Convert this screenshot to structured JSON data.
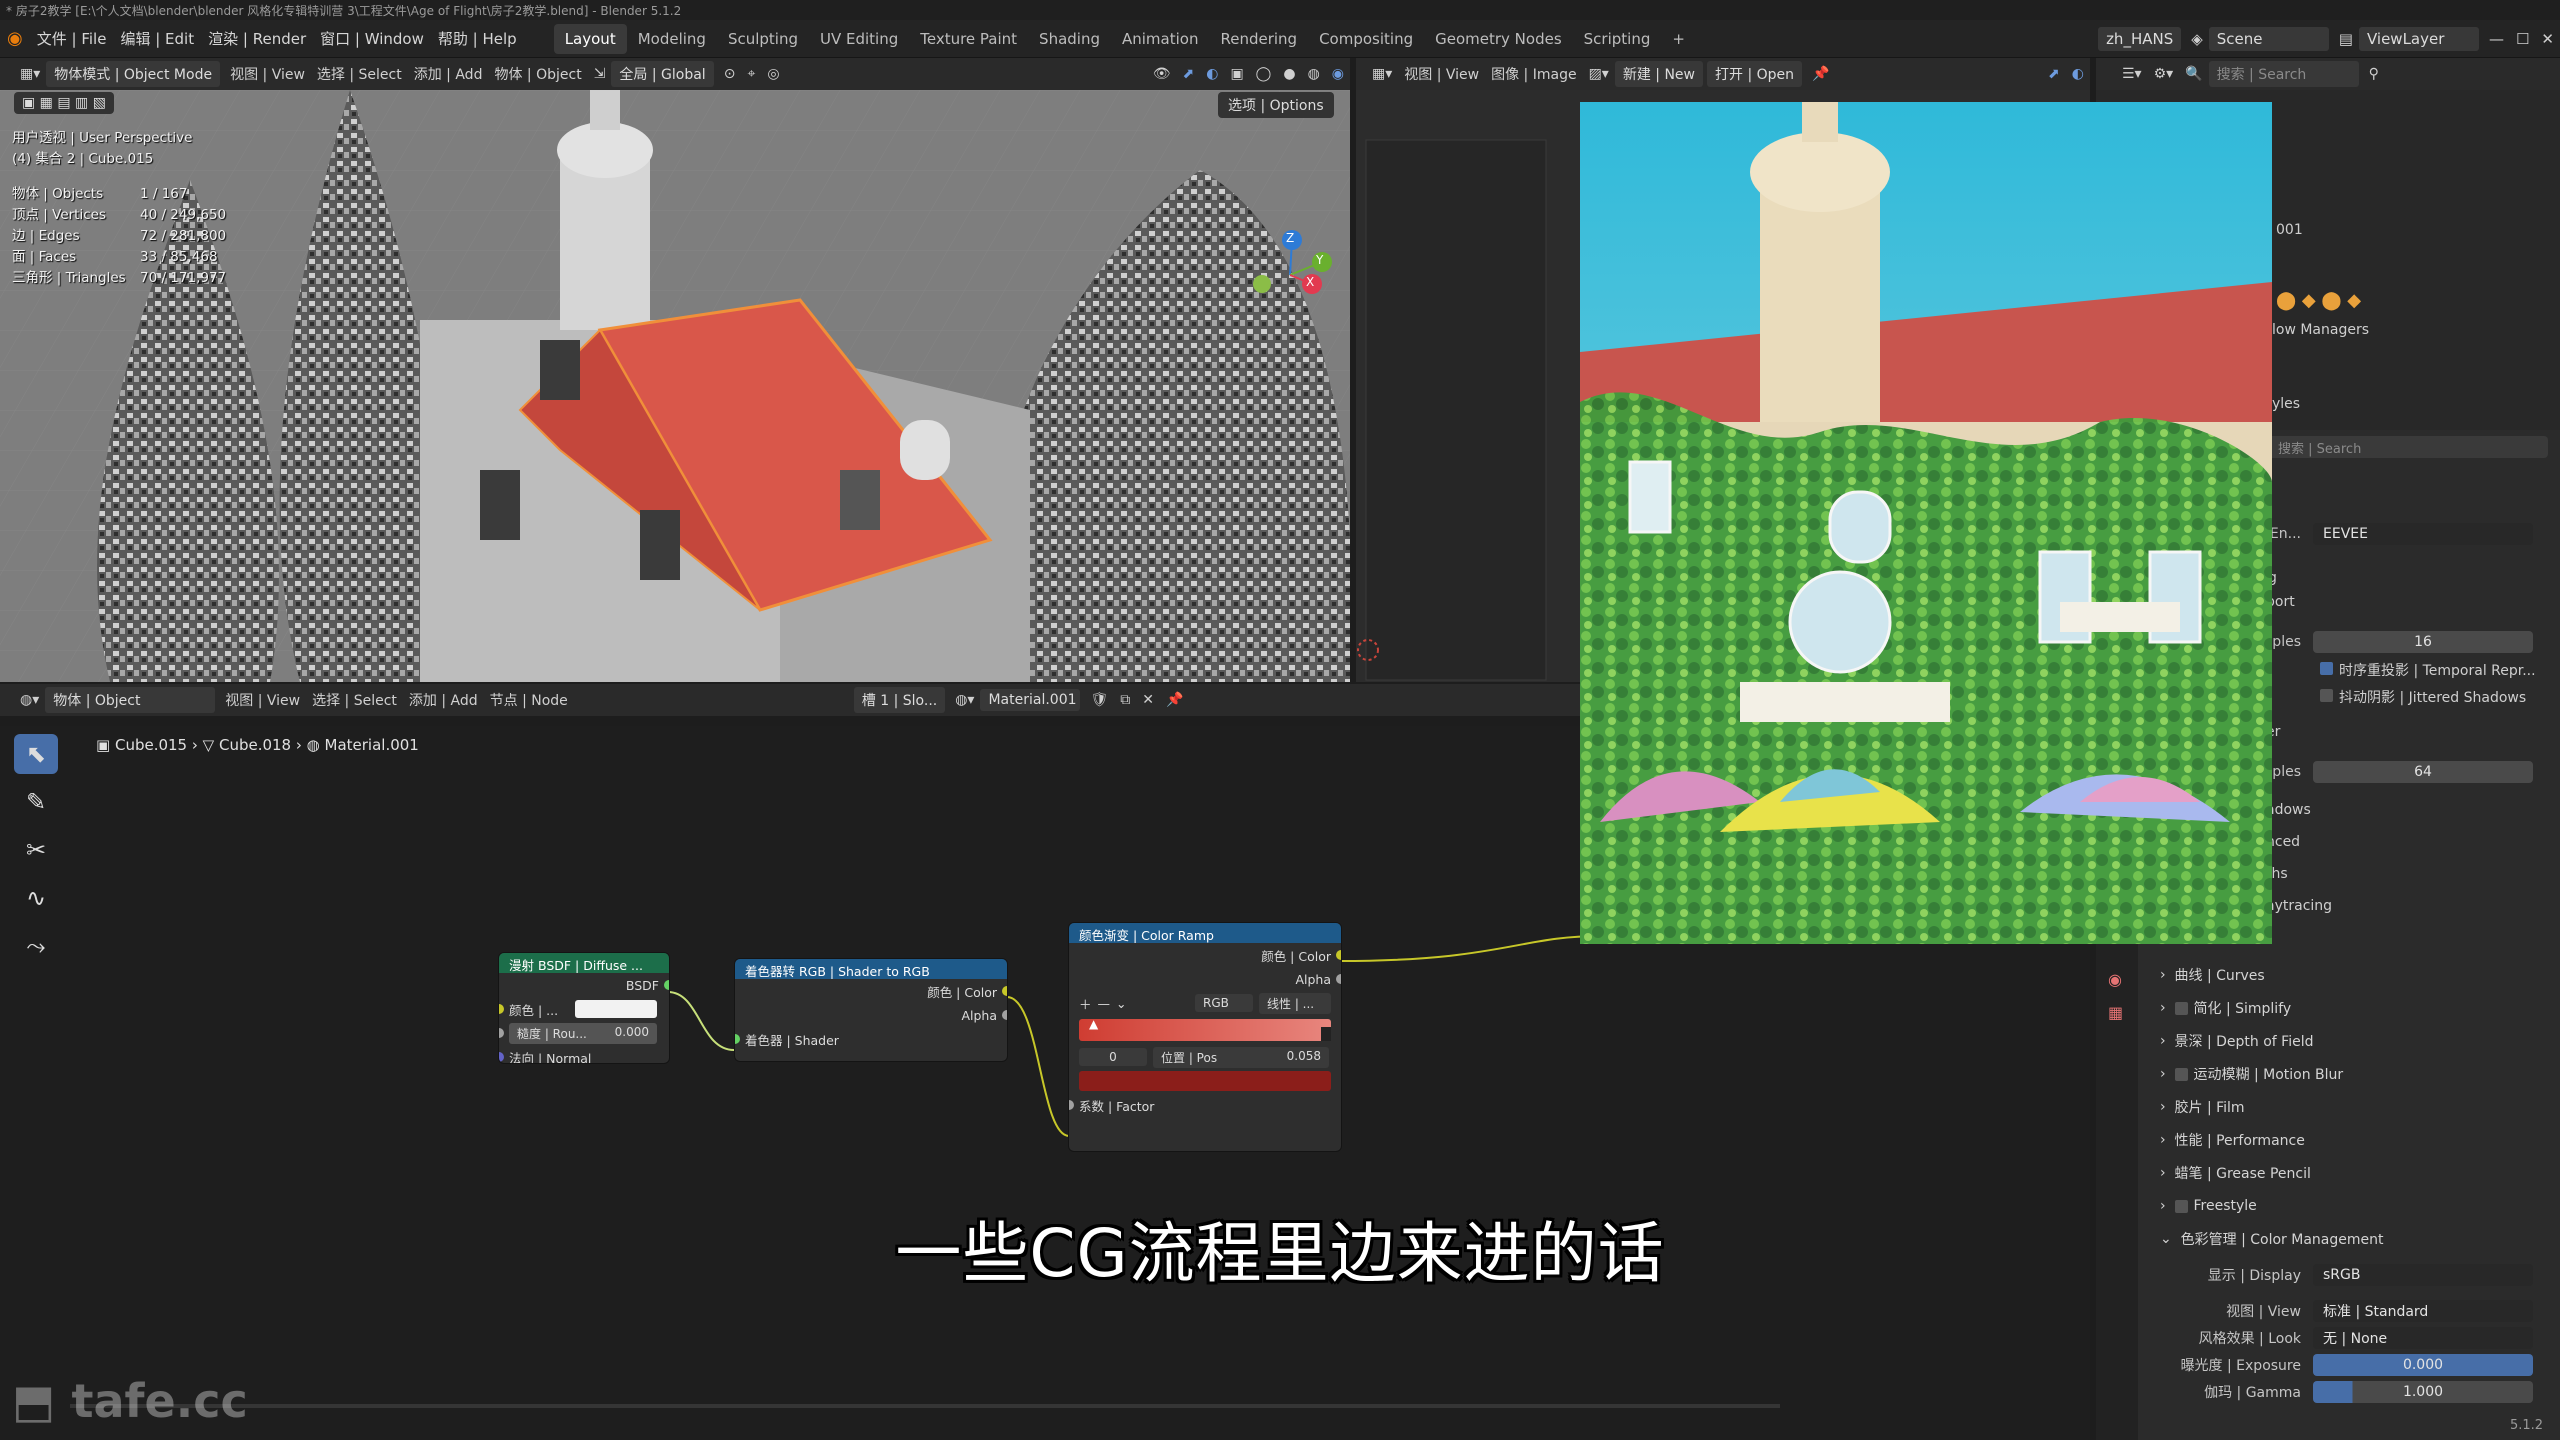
{
  "window": {
    "title": "* 房子2教学 [E:\\个人文档\\blender\\blender 风格化专辑特训营 3\\工程文件\\Age of Flight\\房子2教学.blend] - Blender 5.1.2",
    "version": "5.1.2"
  },
  "menu": [
    {
      "zh": "文件",
      "en": "File"
    },
    {
      "zh": "编辑",
      "en": "Edit"
    },
    {
      "zh": "渲染",
      "en": "Render"
    },
    {
      "zh": "窗口",
      "en": "Window"
    },
    {
      "zh": "帮助",
      "en": "Help"
    }
  ],
  "workspaces": [
    "Layout",
    "Modeling",
    "Sculpting",
    "UV Editing",
    "Texture Paint",
    "Shading",
    "Animation",
    "Rendering",
    "Compositing",
    "Geometry Nodes",
    "Scripting"
  ],
  "active_workspace": "Layout",
  "top_right": {
    "language": "zh_HANS",
    "scene": "Scene",
    "view_layer": "ViewLayer"
  },
  "viewport": {
    "header": {
      "mode": "物体模式 | Object Mode",
      "view": "视图 | View",
      "select": "选择 | Select",
      "add": "添加 | Add",
      "object": "物体 | Object",
      "transform": "全局 | Global",
      "options": "选项 | Options"
    },
    "info_line1": "用户透视 | User Perspective",
    "info_line2": "(4) 集合 2 | Cube.015",
    "stats": [
      {
        "k": "物体 | Objects",
        "v": "1 / 167"
      },
      {
        "k": "顶点 | Vertices",
        "v": "40 / 249,650"
      },
      {
        "k": "边 | Edges",
        "v": "72 / 281,800"
      },
      {
        "k": "面 | Faces",
        "v": "33 / 85,468"
      },
      {
        "k": "三角形 | Triangles",
        "v": "70 / 171,977"
      }
    ],
    "axes": {
      "z": "Z",
      "y": "Y",
      "x": "X"
    }
  },
  "image_editor": {
    "view": "视图 | View",
    "image": "图像 | Image",
    "new": "新建 | New",
    "open": "打开 | Open"
  },
  "outliner": {
    "search_placeholder": "搜索 | Search",
    "item_text": "001",
    "managers": "low Managers",
    "styles": "yles"
  },
  "node_editor": {
    "header": {
      "object": "物体 | Object",
      "view": "视图 | View",
      "select": "选择 | Select",
      "add": "添加 | Add",
      "node": "节点 | Node",
      "slot": "槽 1 | Slo...",
      "material": "Material.001"
    },
    "breadcrumb": [
      "Cube.015",
      "Cube.018",
      "Material.001"
    ],
    "nodes": {
      "diffuse": {
        "title": "漫射 BSDF | Diffuse ...",
        "out": "BSDF",
        "color": "颜色 | ...",
        "rough_label": "糙度 | Rou...",
        "rough_value": "0.000",
        "normal": "法向 | Normal"
      },
      "s2r": {
        "title": "着色器转 RGB | Shader to RGB",
        "color": "颜色 | Color",
        "alpha": "Alpha",
        "shader": "着色器 | Shader"
      },
      "ramp": {
        "title": "颜色渐变 | Color Ramp",
        "color": "颜色 | Color",
        "alpha": "Alpha",
        "mode": "RGB",
        "interp": "线性 | ...",
        "index": "0",
        "pos_label": "位置 | Pos",
        "pos_value": "0.058",
        "factor": "系数 | Factor",
        "ramp_start": "#cf3d32",
        "ramp_end": "#e8867e",
        "swatch": "#8b1e1a"
      }
    }
  },
  "properties": {
    "search_placeholder": "搜索 | Search",
    "engine_label": "En...",
    "engine": "EEVEE",
    "rows": [
      {
        "label": "nples",
        "value": "16"
      },
      {
        "label": "nples",
        "value": "64"
      }
    ],
    "temporal": "时序重投影 | Temporal Repr...",
    "jittered": "抖动阴影 | Jittered Shadows",
    "fragments": [
      "g",
      "port",
      "er",
      "adows",
      "nced",
      "ths",
      "aytracing"
    ],
    "sections": [
      "曲线 | Curves",
      "简化 | Simplify",
      "景深 | Depth of Field",
      "运动模糊 | Motion Blur",
      "胶片 | Film",
      "性能 | Performance",
      "蜡笔 | Grease Pencil",
      "Freestyle",
      "色彩管理 | Color Management"
    ],
    "color_mgmt": [
      {
        "label": "显示 | Display",
        "value": "sRGB"
      },
      {
        "label": "视图 | View",
        "value": "标准 | Standard"
      },
      {
        "label": "风格效果 | Look",
        "value": "无 | None"
      },
      {
        "label": "曝光度 | Exposure",
        "value": "0.000"
      },
      {
        "label": "伽玛 | Gamma",
        "value": "1.000"
      }
    ]
  },
  "subtitle": "一些CG流程里边来进的话",
  "watermark": "tafe.cc",
  "colors": {
    "accent": "#476ea8",
    "selection_orange": "#f08f3a",
    "roof": "#d9574a"
  }
}
